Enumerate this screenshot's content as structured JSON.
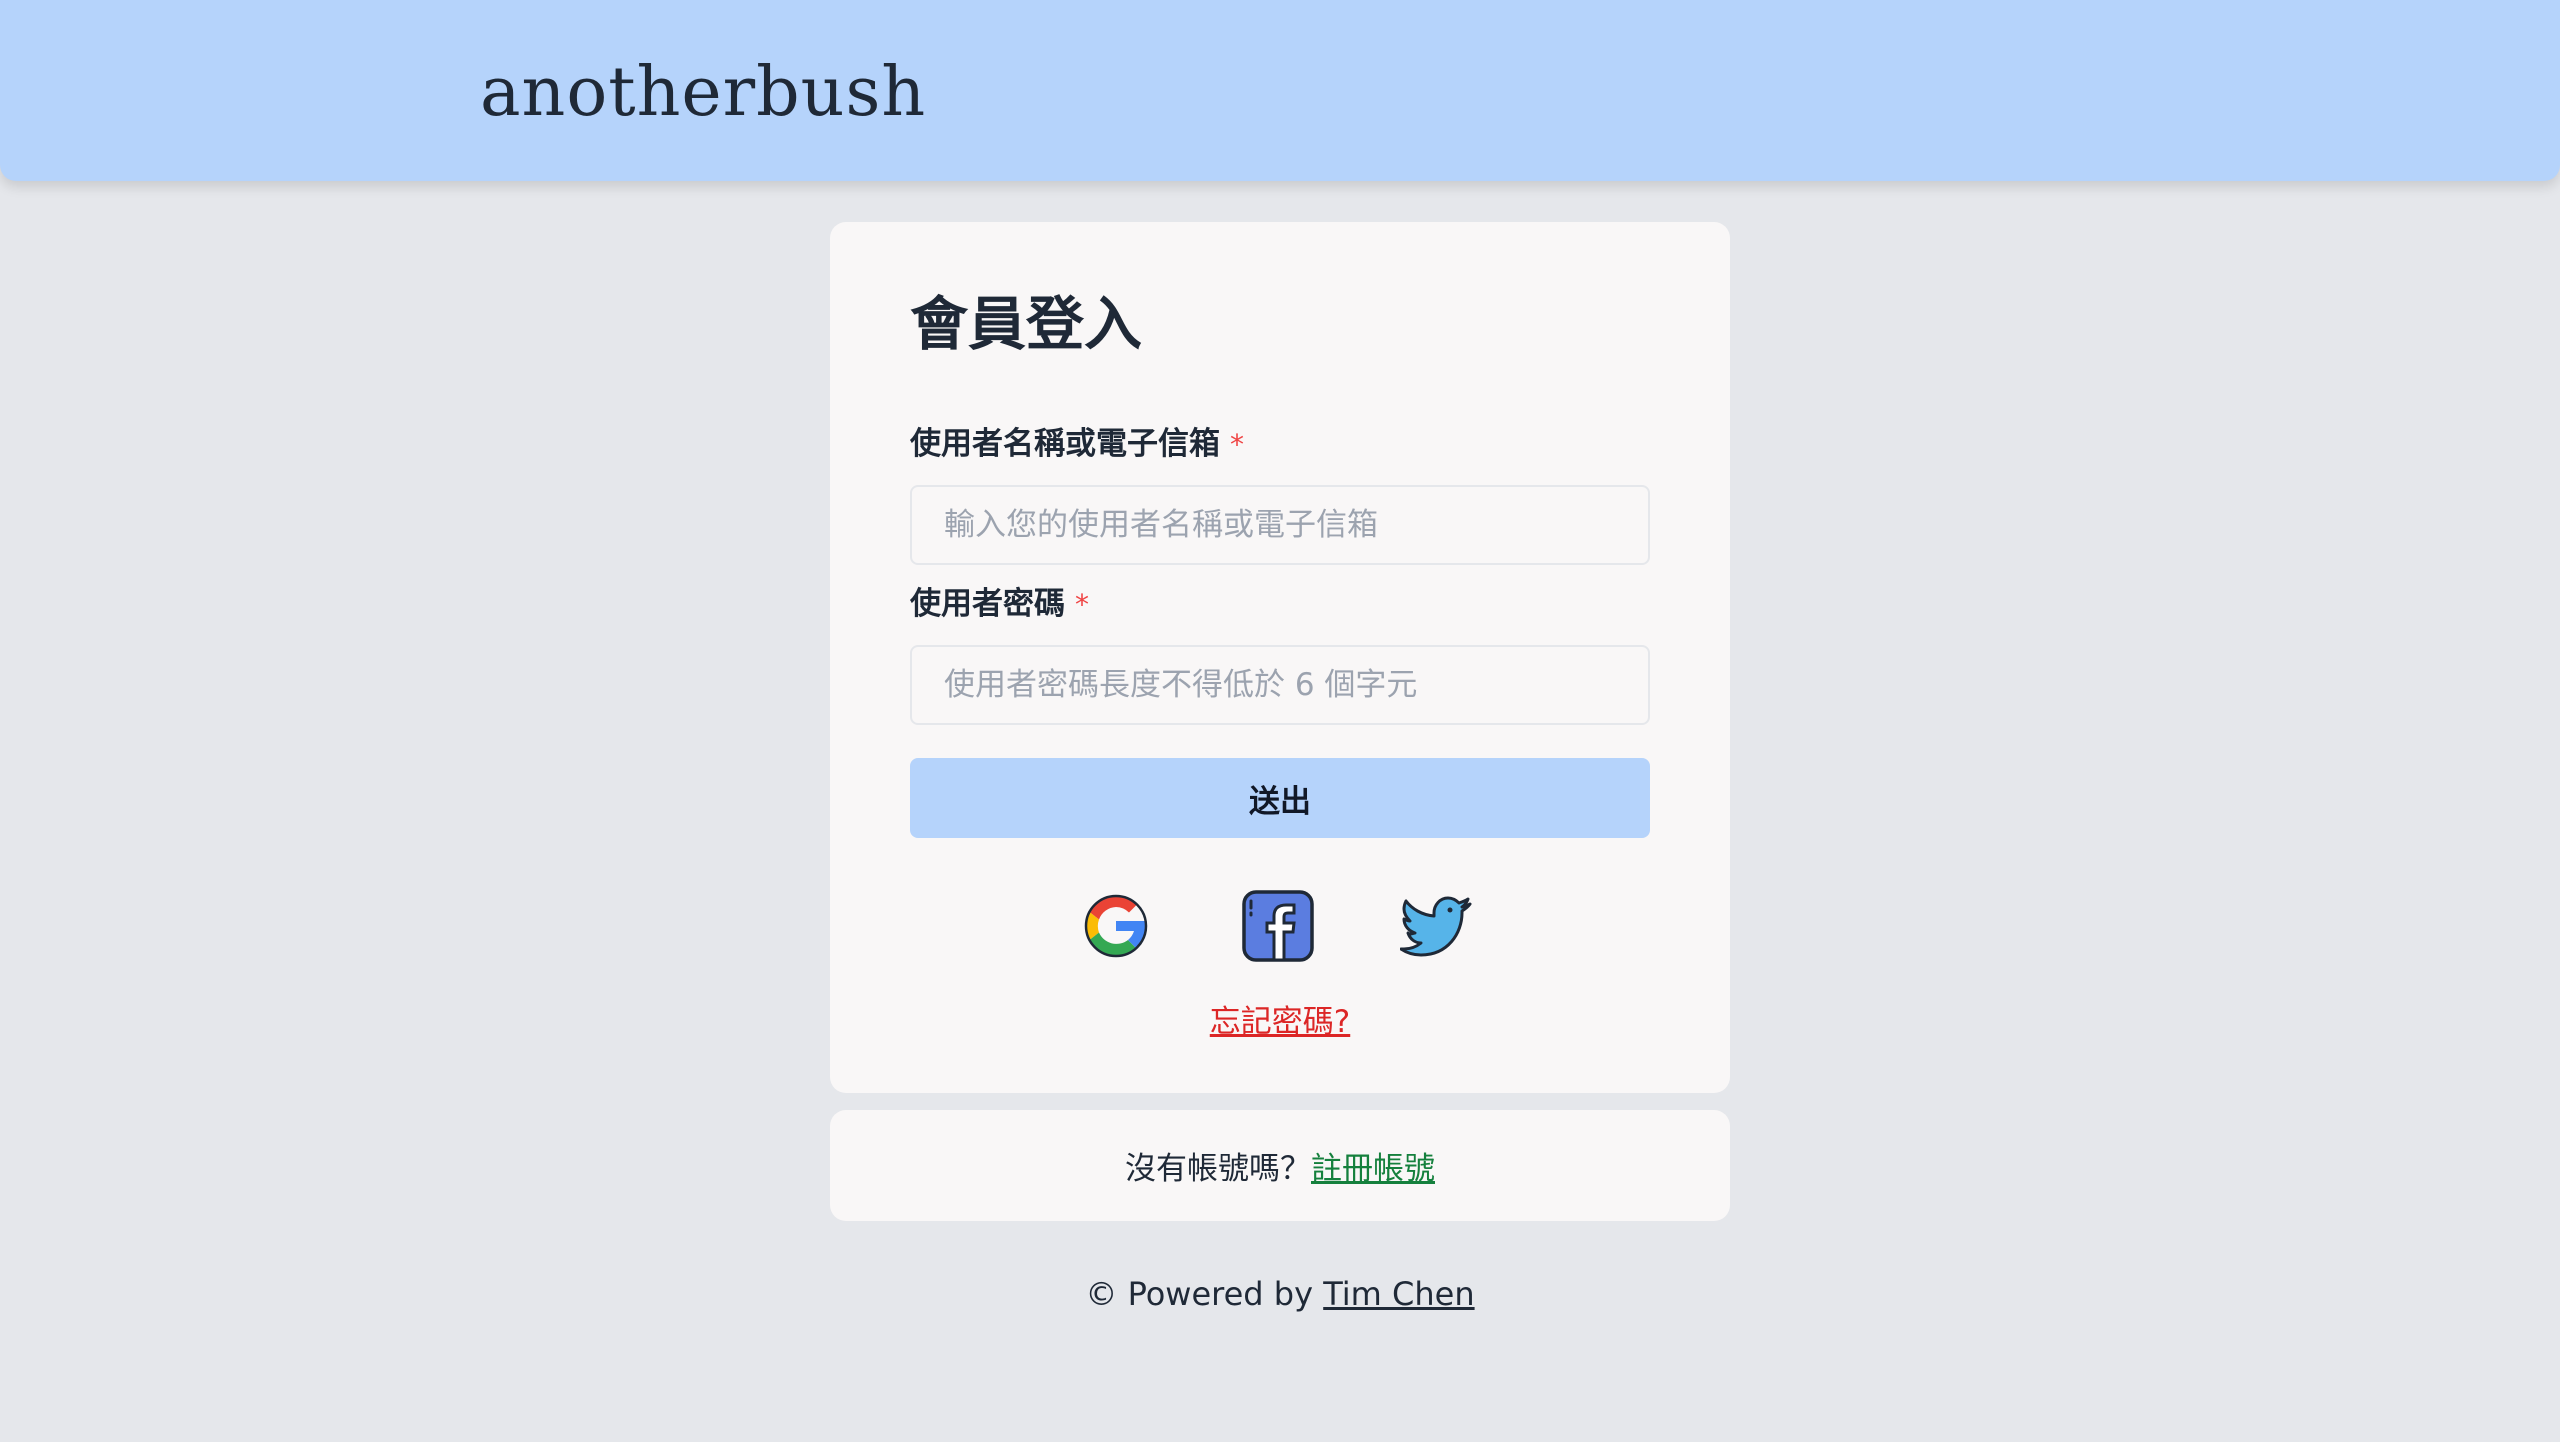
{
  "header": {
    "brand": "anotherbush"
  },
  "login": {
    "title": "會員登入",
    "username_label": "使用者名稱或電子信箱",
    "required_mark": "*",
    "username_placeholder": "輸入您的使用者名稱或電子信箱",
    "username_value": "",
    "password_label": "使用者密碼",
    "password_placeholder": "使用者密碼長度不得低於 6 個字元",
    "password_value": "",
    "submit_label": "送出",
    "social": [
      {
        "name": "google",
        "icon": "google-icon"
      },
      {
        "name": "facebook",
        "icon": "facebook-icon"
      },
      {
        "name": "twitter",
        "icon": "twitter-icon"
      }
    ],
    "forgot_password": "忘記密碼?"
  },
  "register": {
    "prompt": "沒有帳號嗎？",
    "link": "註冊帳號"
  },
  "footer": {
    "powered_by": "© Powered by ",
    "author": "Tim Chen"
  },
  "colors": {
    "background": "#e5e7eb",
    "header": "#b5d3fb",
    "card": "#f9f7f7",
    "required": "#ef4444",
    "forgot_link": "#dc2626",
    "register_link": "#15803d",
    "facebook": "#5b7de0",
    "twitter": "#56b4e9"
  }
}
